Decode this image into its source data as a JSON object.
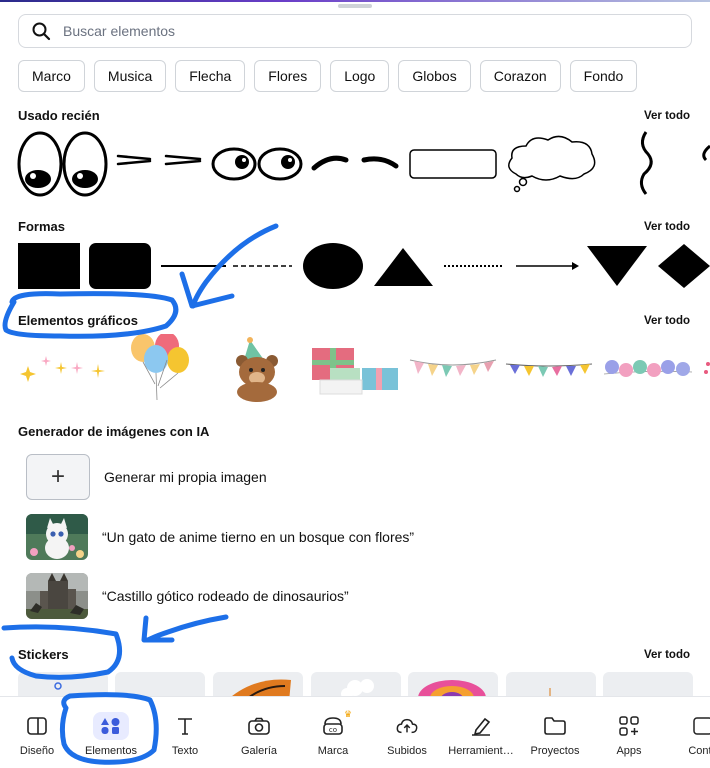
{
  "search": {
    "placeholder": "Buscar elementos"
  },
  "chips": [
    "Marco",
    "Musica",
    "Flecha",
    "Flores",
    "Logo",
    "Globos",
    "Corazon",
    "Fondo"
  ],
  "sections": {
    "recent": {
      "title": "Usado recién",
      "see_all": "Ver todo"
    },
    "shapes": {
      "title": "Formas",
      "see_all": "Ver todo"
    },
    "graphics": {
      "title": "Elementos gráficos",
      "see_all": "Ver todo"
    },
    "ai": {
      "title": "Generador de imágenes con IA",
      "items": [
        {
          "label": "Generar mi propia imagen"
        },
        {
          "label": "“Un gato de anime tierno en un bosque con flores”"
        },
        {
          "label": "“Castillo gótico rodeado de dinosaurios”"
        }
      ]
    },
    "stickers": {
      "title": "Stickers",
      "see_all": "Ver todo"
    }
  },
  "nav": {
    "items": [
      {
        "label": "Diseño",
        "icon": "layout-icon"
      },
      {
        "label": "Elementos",
        "icon": "elements-icon",
        "active": true
      },
      {
        "label": "Texto",
        "icon": "text-icon"
      },
      {
        "label": "Galería",
        "icon": "camera-icon"
      },
      {
        "label": "Marca",
        "icon": "brand-icon",
        "premium": true
      },
      {
        "label": "Subidos",
        "icon": "cloud-upload-icon"
      },
      {
        "label": "Herramient…",
        "icon": "pen-tool-icon"
      },
      {
        "label": "Proyectos",
        "icon": "folder-icon"
      },
      {
        "label": "Apps",
        "icon": "apps-icon"
      },
      {
        "label": "Conte",
        "icon": "content-icon"
      }
    ]
  },
  "colors": {
    "accent": "#3b5bdb",
    "annotation": "#1d6fe8",
    "premium": "#f2a200"
  }
}
